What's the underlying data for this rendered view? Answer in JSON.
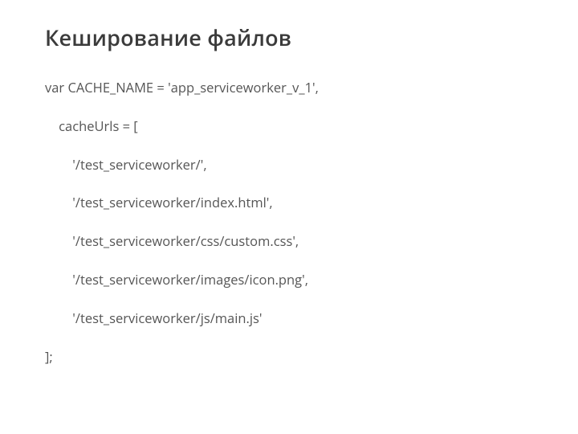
{
  "title": "Кеширование файлов",
  "code": {
    "l1": "var CACHE_NAME = 'app_serviceworker_v_1',",
    "l2": "    cacheUrls = [",
    "l3": "        '/test_serviceworker/',",
    "l4": "        '/test_serviceworker/index.html',",
    "l5": "        '/test_serviceworker/css/custom.css',",
    "l6": "        '/test_serviceworker/images/icon.png',",
    "l7": "        '/test_serviceworker/js/main.js'",
    "l8": "];"
  }
}
